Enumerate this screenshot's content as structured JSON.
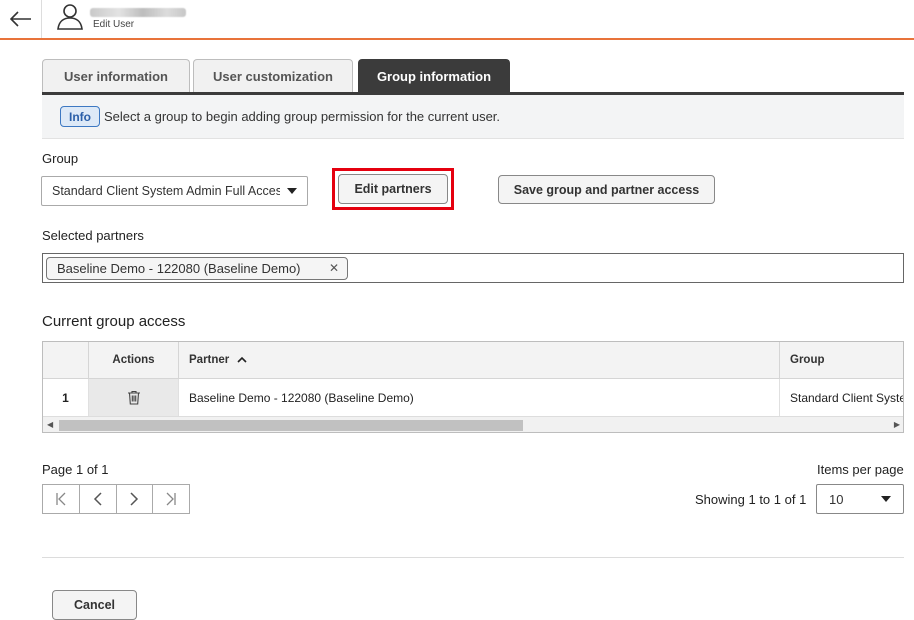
{
  "header": {
    "edit_user_label": "Edit User"
  },
  "tabs": [
    {
      "label": "User information",
      "active": false
    },
    {
      "label": "User customization",
      "active": false
    },
    {
      "label": "Group information",
      "active": true
    }
  ],
  "info": {
    "badge": "Info",
    "message": "Select a group to begin adding group permission for the current user."
  },
  "group": {
    "label": "Group",
    "selected_value": "Standard Client System Admin Full Access",
    "edit_partners_label": "Edit partners",
    "save_label": "Save group and partner access"
  },
  "selected_partners": {
    "label": "Selected partners",
    "chips": [
      "Baseline Demo - 122080 (Baseline Demo)"
    ]
  },
  "current_access": {
    "title": "Current group access",
    "columns": {
      "actions": "Actions",
      "partner": "Partner",
      "group": "Group"
    },
    "rows": [
      {
        "index": "1",
        "partner": "Baseline Demo - 122080 (Baseline Demo)",
        "group": "Standard Client System Admin Full Access"
      }
    ]
  },
  "pagination": {
    "page_label": "Page 1 of 1",
    "items_per_page_label": "Items per page",
    "showing": "Showing 1 to 1 of 1",
    "items_per_page": "10"
  },
  "footer": {
    "cancel_label": "Cancel"
  },
  "colors": {
    "accent_orange": "#e8733a",
    "active_tab": "#3b3b3b",
    "highlight_red": "#e5000f",
    "info_blue": "#3d78c2"
  }
}
